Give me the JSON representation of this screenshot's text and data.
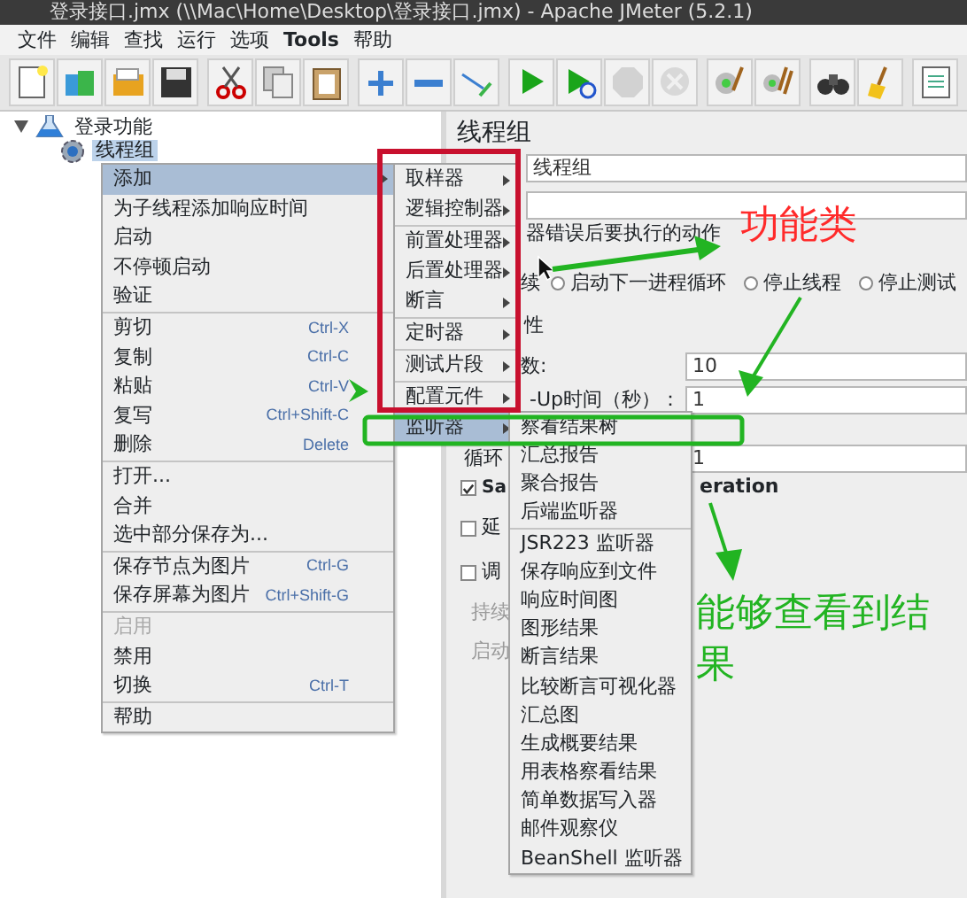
{
  "window": {
    "title": "登录接口.jmx (\\\\Mac\\Home\\Desktop\\登录接口.jmx) - Apache JMeter (5.2.1)"
  },
  "menubar": [
    {
      "label": "文件",
      "bold": false
    },
    {
      "label": "编辑",
      "bold": false
    },
    {
      "label": "查找",
      "bold": false
    },
    {
      "label": "运行",
      "bold": false
    },
    {
      "label": "选项",
      "bold": false
    },
    {
      "label": "Tools",
      "bold": true
    },
    {
      "label": "帮助",
      "bold": false
    }
  ],
  "toolbar": [
    {
      "disabled": false
    },
    {
      "disabled": false
    },
    {
      "disabled": false
    },
    {
      "disabled": false
    },
    {
      "disabled": false
    },
    {
      "disabled": false
    },
    {
      "disabled": false
    },
    {
      "disabled": false
    },
    {
      "disabled": false
    },
    {
      "disabled": false
    },
    {
      "disabled": false
    },
    {
      "disabled": false
    },
    {
      "disabled": true
    },
    {
      "disabled": true
    },
    {
      "disabled": false
    },
    {
      "disabled": false
    },
    {
      "disabled": false
    },
    {
      "disabled": false
    },
    {
      "disabled": false
    }
  ],
  "tree": [
    {
      "label": "登录功能",
      "selected": false,
      "expanded": true,
      "children": [
        {
          "label": "线程组",
          "selected": true
        }
      ]
    }
  ],
  "thread_group": {
    "title": "线程组",
    "rows": [
      {
        "kind": "field",
        "value": "线程组"
      },
      {
        "kind": "field"
      },
      {
        "kind": "text",
        "label": "器错误后要执行的动作"
      },
      {
        "kind": "radios",
        "label": "续",
        "options": [
          {
            "label": "启动下一进程循环",
            "selected": false
          },
          {
            "label": "停止线程",
            "selected": false
          },
          {
            "label": "停止测试",
            "selected": false
          }
        ]
      },
      {
        "kind": "text",
        "label": "性"
      },
      {
        "kind": "labeled_field",
        "label": "数:",
        "value": "10"
      },
      {
        "kind": "labeled_field",
        "label": "-Up时间（秒）：",
        "value": "1"
      },
      {
        "kind": "labeled_field",
        "label": "循环",
        "value": "1"
      },
      {
        "kind": "checkbox",
        "label": "Sa",
        "tail": "eration",
        "checked": true
      },
      {
        "kind": "checkbox",
        "label": "延",
        "checked": false
      },
      {
        "kind": "checkbox",
        "label": "调",
        "checked": false
      },
      {
        "kind": "text",
        "label": "持续",
        "disabled": true
      },
      {
        "kind": "text",
        "label": "启动",
        "disabled": true
      }
    ]
  },
  "context_menu": {
    "groups": [
      {
        "items": [
          {
            "label": "添加",
            "selected": true,
            "submenu": true
          },
          {
            "label": "为子线程添加响应时间",
            "selected": false
          },
          {
            "label": "启动",
            "selected": false
          },
          {
            "label": "不停顿启动",
            "selected": false
          },
          {
            "label": "验证",
            "selected": false
          }
        ]
      },
      {
        "items": [
          {
            "label": "剪切",
            "shortcut": "Ctrl-X",
            "selected": false
          },
          {
            "label": "复制",
            "shortcut": "Ctrl-C",
            "selected": false
          },
          {
            "label": "粘贴",
            "shortcut": "Ctrl-V",
            "selected": false
          },
          {
            "label": "复写",
            "shortcut": "Ctrl+Shift-C",
            "selected": false
          },
          {
            "label": "删除",
            "shortcut": "Delete",
            "selected": false
          }
        ]
      },
      {
        "items": [
          {
            "label": "打开...",
            "selected": false
          },
          {
            "label": "合并",
            "selected": false
          },
          {
            "label": "选中部分保存为...",
            "selected": false
          }
        ]
      },
      {
        "items": [
          {
            "label": "保存节点为图片",
            "shortcut": "Ctrl-G",
            "selected": false
          },
          {
            "label": "保存屏幕为图片",
            "shortcut": "Ctrl+Shift-G",
            "selected": false
          }
        ]
      },
      {
        "items": [
          {
            "label": "启用",
            "selected": false,
            "disabled": true
          },
          {
            "label": "禁用",
            "selected": false
          },
          {
            "label": "切换",
            "shortcut": "Ctrl-T",
            "selected": false
          }
        ]
      },
      {
        "items": [
          {
            "label": "帮助",
            "selected": false
          }
        ]
      }
    ]
  },
  "add_submenu": {
    "groups": [
      {
        "items": [
          {
            "label": "取样器",
            "selected": false,
            "submenu": true
          },
          {
            "label": "逻辑控制器",
            "selected": false,
            "submenu": true
          }
        ]
      },
      {
        "items": [
          {
            "label": "前置处理器",
            "selected": false,
            "submenu": true
          },
          {
            "label": "后置处理器",
            "selected": false,
            "submenu": true
          },
          {
            "label": "断言",
            "selected": false,
            "submenu": true
          }
        ]
      },
      {
        "items": [
          {
            "label": "定时器",
            "selected": false,
            "submenu": true
          }
        ]
      },
      {
        "items": [
          {
            "label": "测试片段",
            "selected": false,
            "submenu": true
          }
        ]
      },
      {
        "items": [
          {
            "label": "配置元件",
            "selected": false,
            "submenu": true
          },
          {
            "label": "监听器",
            "selected": true,
            "submenu": true
          }
        ]
      }
    ]
  },
  "listener_submenu": {
    "groups": [
      {
        "items": [
          {
            "label": "察看结果树",
            "selected": false
          },
          {
            "label": "汇总报告",
            "selected": false
          },
          {
            "label": "聚合报告",
            "selected": false
          },
          {
            "label": "后端监听器",
            "selected": false
          }
        ]
      },
      {
        "items": [
          {
            "label": "JSR223 监听器",
            "selected": false
          },
          {
            "label": "保存响应到文件",
            "selected": false
          },
          {
            "label": "响应时间图",
            "selected": false
          },
          {
            "label": "图形结果",
            "selected": false
          },
          {
            "label": "断言结果",
            "selected": false
          },
          {
            "label": "比较断言可视化器",
            "selected": false
          },
          {
            "label": "汇总图",
            "selected": false
          },
          {
            "label": "生成概要结果",
            "selected": false
          },
          {
            "label": "用表格察看结果",
            "selected": false
          },
          {
            "label": "简单数据写入器",
            "selected": false
          },
          {
            "label": "邮件观察仪",
            "selected": false
          },
          {
            "label": "BeanShell 监听器",
            "selected": false
          }
        ]
      }
    ]
  },
  "annotations": [
    {
      "kind": "label",
      "text": "功能类",
      "color": "#ff2a2a"
    },
    {
      "kind": "label",
      "text": "能够查看到结果",
      "color": "#22b422"
    }
  ]
}
